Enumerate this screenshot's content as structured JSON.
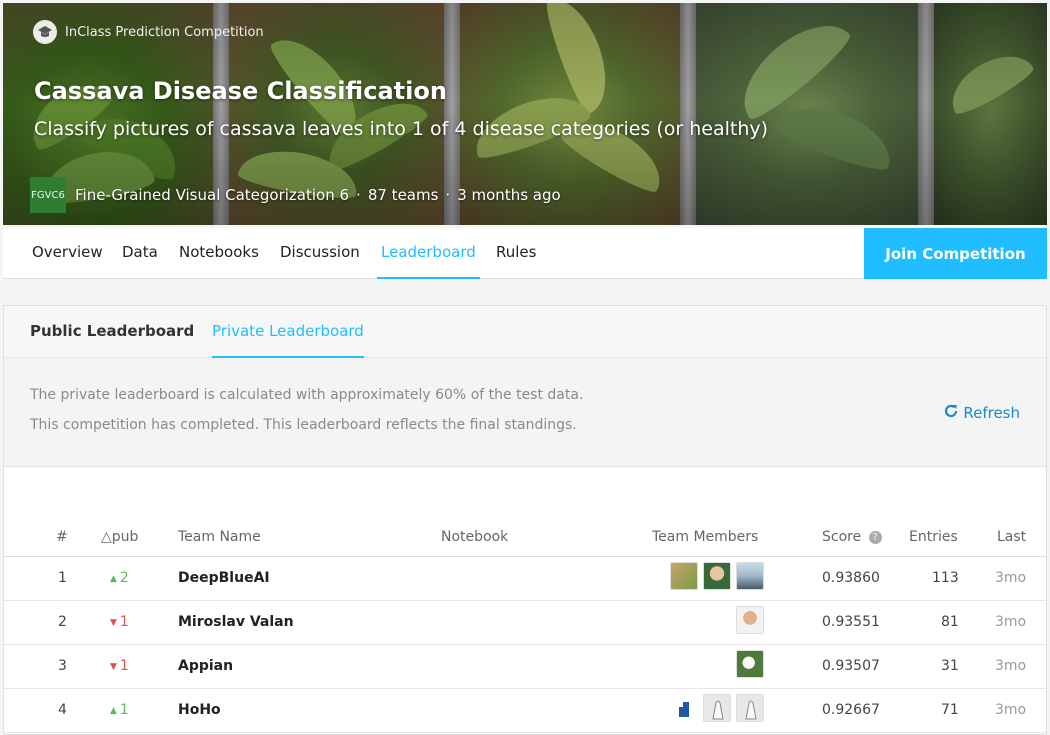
{
  "banner": {
    "competition_type": "InClass Prediction Competition",
    "title": "Cassava Disease Classification",
    "subtitle": "Classify pictures of cassava leaves into 1 of 4 disease categories (or healthy)",
    "host_logo_text": "FGVC6",
    "host_name": "Fine-Grained Visual Categorization 6",
    "teams": "87 teams",
    "time_ago": "3 months ago",
    "separator": "·"
  },
  "nav": {
    "tabs": [
      "Overview",
      "Data",
      "Notebooks",
      "Discussion",
      "Leaderboard",
      "Rules"
    ],
    "active_tab": "Leaderboard",
    "join_label": "Join Competition"
  },
  "leaderboard": {
    "tabs": [
      "Public Leaderboard",
      "Private Leaderboard"
    ],
    "active_tab": "Private Leaderboard",
    "info_line1": "The private leaderboard is calculated with approximately 60% of the test data.",
    "info_line2": "This competition has completed. This leaderboard reflects the final standings.",
    "refresh_label": "Refresh",
    "columns": [
      "#",
      "△pub",
      "Team Name",
      "Notebook",
      "Team Members",
      "Score",
      "Entries",
      "Last"
    ],
    "rows": [
      {
        "rank": "1",
        "change": "2",
        "direction": "up",
        "team": "DeepBlueAI",
        "score": "0.93860",
        "entries": "113",
        "last": "3mo"
      },
      {
        "rank": "2",
        "change": "1",
        "direction": "down",
        "team": "Miroslav Valan",
        "score": "0.93551",
        "entries": "81",
        "last": "3mo"
      },
      {
        "rank": "3",
        "change": "1",
        "direction": "down",
        "team": "Appian",
        "score": "0.93507",
        "entries": "31",
        "last": "3mo"
      },
      {
        "rank": "4",
        "change": "1",
        "direction": "up",
        "team": "HoHo",
        "score": "0.92667",
        "entries": "71",
        "last": "3mo"
      }
    ]
  },
  "colors": {
    "accent": "#20beff",
    "up": "#5cb85c",
    "down": "#d9534f"
  }
}
